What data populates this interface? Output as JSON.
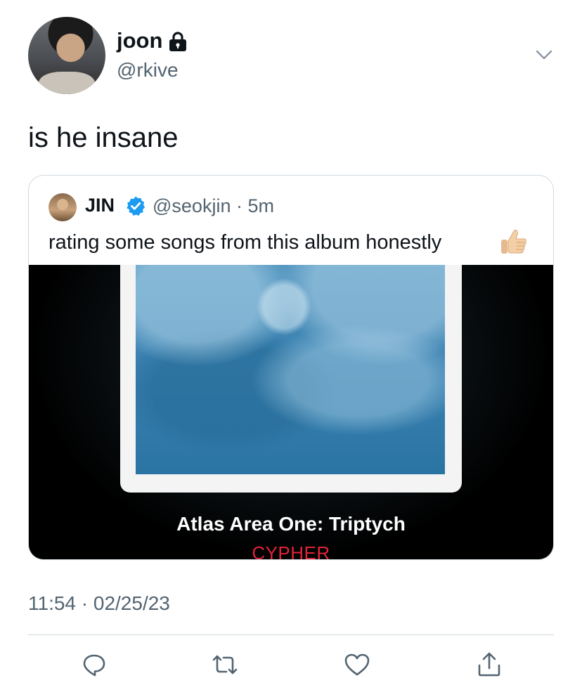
{
  "tweet": {
    "author_name": "joon",
    "author_handle": "@rkive",
    "text": "is he insane",
    "timestamp": "11:54 · 02/25/23"
  },
  "quoted_tweet": {
    "author_name": "JIN",
    "author_handle": "@seokjin · 5m",
    "text": "rating some songs from this album honestly",
    "media": {
      "album_title": "Atlas Area One: Triptych",
      "track_name": "CYPHER"
    }
  },
  "icons": [
    "lock-icon",
    "chevron-down-icon",
    "verified-badge-icon",
    "thumbs-up-emoji",
    "reply-icon",
    "retweet-icon",
    "like-icon",
    "share-icon"
  ],
  "colors": {
    "accent": "#1d9bf0",
    "secondary_text": "#536471",
    "track_red": "#e0243a",
    "border": "#cfd9de"
  }
}
